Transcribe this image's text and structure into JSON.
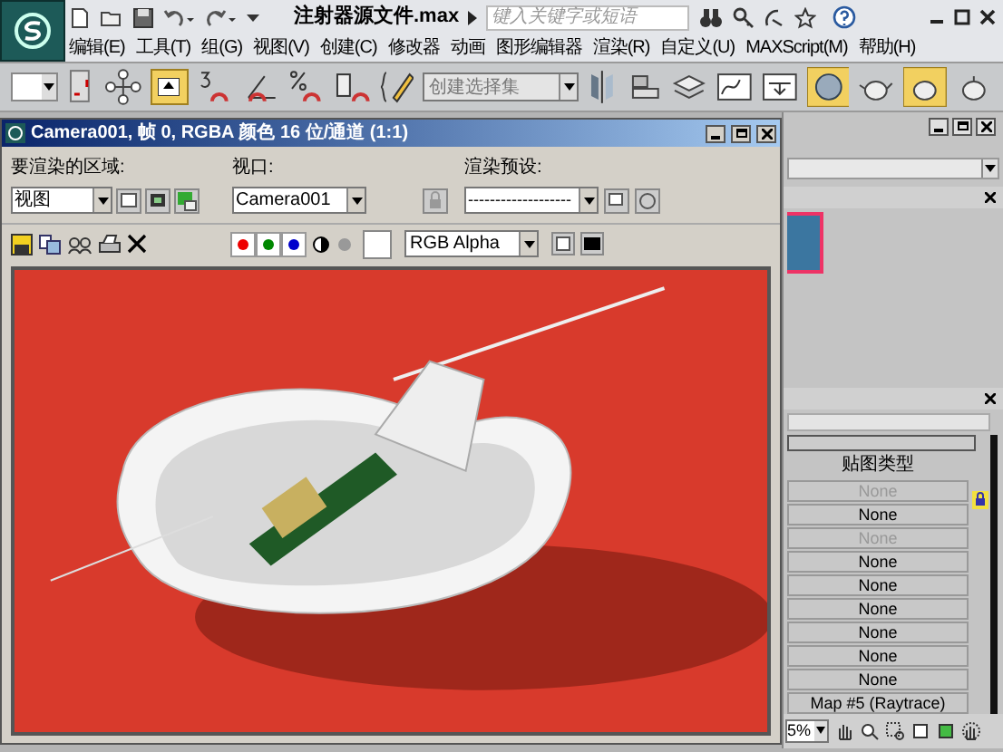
{
  "app": {
    "title": "注射器源文件.max",
    "search": {
      "placeholder": "键入关键字或短语"
    }
  },
  "menu": [
    "编辑(E)",
    "工具(T)",
    "组(G)",
    "视图(V)",
    "创建(C)",
    "修改器",
    "动画",
    "图形编辑器",
    "渲染(R)",
    "自定义(U)",
    "MAXScript(M)",
    "帮助(H)"
  ],
  "toolbar": {
    "selection_set": {
      "placeholder": "创建选择集"
    }
  },
  "render_window": {
    "title": "Camera001, 帧 0, RGBA 颜色 16 位/通道 (1:1)",
    "area_label": "要渲染的区域:",
    "area_value": "视图",
    "viewport_label": "视口:",
    "viewport_value": "Camera001",
    "preset_label": "渲染预设:",
    "preset_value": "-------------------",
    "channel_value": "RGB Alpha"
  },
  "material_panel": {
    "heading": "贴图类型",
    "slots": [
      {
        "label": "None",
        "disabled": true
      },
      {
        "label": "None",
        "disabled": false
      },
      {
        "label": "None",
        "disabled": true
      },
      {
        "label": "None",
        "disabled": false
      },
      {
        "label": "None",
        "disabled": false
      },
      {
        "label": "None",
        "disabled": false
      },
      {
        "label": "None",
        "disabled": false
      },
      {
        "label": "None",
        "disabled": false
      },
      {
        "label": "None",
        "disabled": false
      },
      {
        "label": "Map #5 (Raytrace)",
        "disabled": false
      }
    ]
  },
  "zoom_field": "5%"
}
